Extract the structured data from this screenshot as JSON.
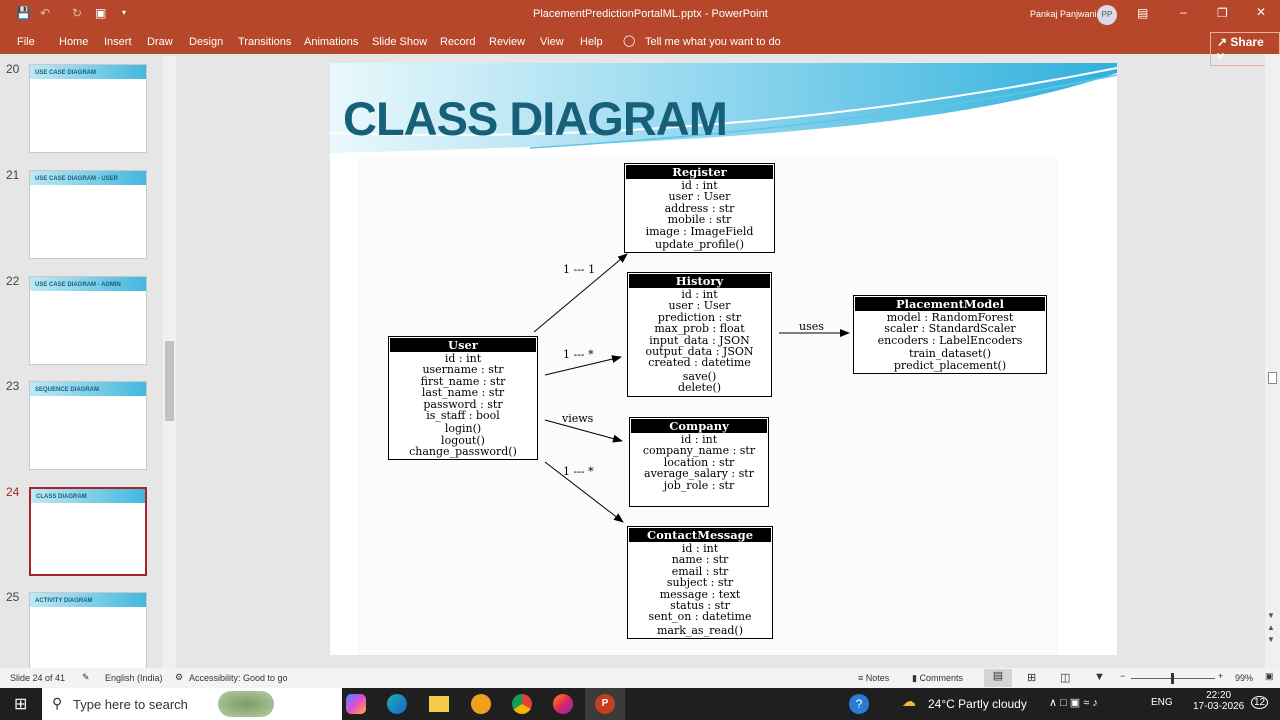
{
  "app": {
    "title": "PlacementPredictionPortalML.pptx  -  PowerPoint",
    "user": "Pankaj Panjwani",
    "avatar": "PP",
    "share": "Share",
    "accent": "#b7472a"
  },
  "ribbon": {
    "tabs": [
      "File",
      "Home",
      "Insert",
      "Draw",
      "Design",
      "Transitions",
      "Animations",
      "Slide Show",
      "Record",
      "Review",
      "View",
      "Help"
    ],
    "tell_me": "Tell me what you want to do"
  },
  "thumbnails": [
    {
      "num": "20",
      "title": "USE CASE DIAGRAM"
    },
    {
      "num": "21",
      "title": "USE CASE DIAGRAM - USER"
    },
    {
      "num": "22",
      "title": "USE CASE DIAGRAM - ADMIN"
    },
    {
      "num": "23",
      "title": "SEQUENCE DIAGRAM"
    },
    {
      "num": "24",
      "title": "CLASS DIAGRAM"
    },
    {
      "num": "25",
      "title": "ACTIVITY DIAGRAM"
    }
  ],
  "slide": {
    "title": "CLASS DIAGRAM",
    "classes": {
      "register": {
        "name": "Register",
        "attrs": [
          "id : int",
          "user : User",
          "address : str",
          "mobile : str",
          "image : ImageField"
        ],
        "methods": [
          "update_profile()"
        ]
      },
      "history": {
        "name": "History",
        "attrs": [
          "id : int",
          "user : User",
          "prediction : str",
          "max_prob : float",
          "input_data : JSON",
          "output_data : JSON",
          "created : datetime"
        ],
        "methods": [
          "save()",
          "delete()"
        ]
      },
      "placement": {
        "name": "PlacementModel",
        "attrs": [
          "model : RandomForest",
          "scaler : StandardScaler",
          "encoders : LabelEncoders"
        ],
        "methods": [
          "train_dataset()",
          "predict_placement()"
        ]
      },
      "user": {
        "name": "User",
        "attrs": [
          "id : int",
          "username : str",
          "first_name : str",
          "last_name : str",
          "password : str",
          "is_staff : bool"
        ],
        "methods": [
          "login()",
          "logout()",
          "change_password()"
        ]
      },
      "company": {
        "name": "Company",
        "attrs": [
          "id : int",
          "company_name : str",
          "location : str",
          "average_salary : str",
          "job_role : str"
        ],
        "methods": []
      },
      "contact": {
        "name": "ContactMessage",
        "attrs": [
          "id : int",
          "name : str",
          "email : str",
          "subject : str",
          "message : text",
          "status : str",
          "sent_on : datetime"
        ],
        "methods": [
          "mark_as_read()"
        ]
      }
    },
    "relations": {
      "user_register": "1 --- 1",
      "user_history": "1 --- *",
      "user_company": "views",
      "user_contact": "1 --- *",
      "history_placement": "uses"
    }
  },
  "status": {
    "slide": "Slide 24 of 41",
    "language": "English (India)",
    "accessibility": "Accessibility: Good to go",
    "notes": "Notes",
    "comments": "Comments",
    "zoom": "99%"
  },
  "taskbar": {
    "search": "Type here to search",
    "weather": "24°C  Partly cloudy",
    "lang": "ENG",
    "time": "22:20",
    "date": "17-03-2026",
    "notif": "12"
  }
}
